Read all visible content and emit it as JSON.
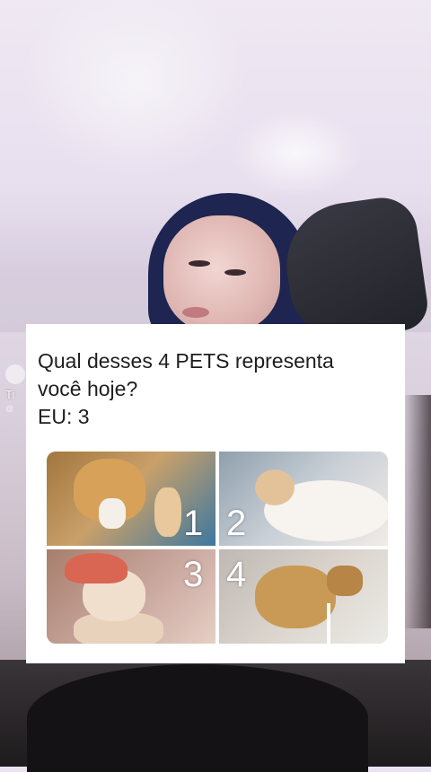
{
  "overlay": {
    "watermark_label": "Ti",
    "watermark_user": "@"
  },
  "card": {
    "question_lines": [
      "Qual desses 4 PETS representa",
      "você hoje?",
      "EU: 3"
    ],
    "pets": [
      {
        "number": "1",
        "icon": "dog-icon"
      },
      {
        "number": "2",
        "icon": "cat-icon"
      },
      {
        "number": "3",
        "icon": "dog-icon"
      },
      {
        "number": "4",
        "icon": "dog-icon"
      }
    ]
  },
  "colors": {
    "card_background": "#ffffff",
    "text": "#1e1e1e",
    "pet_number": "#ffffff"
  }
}
